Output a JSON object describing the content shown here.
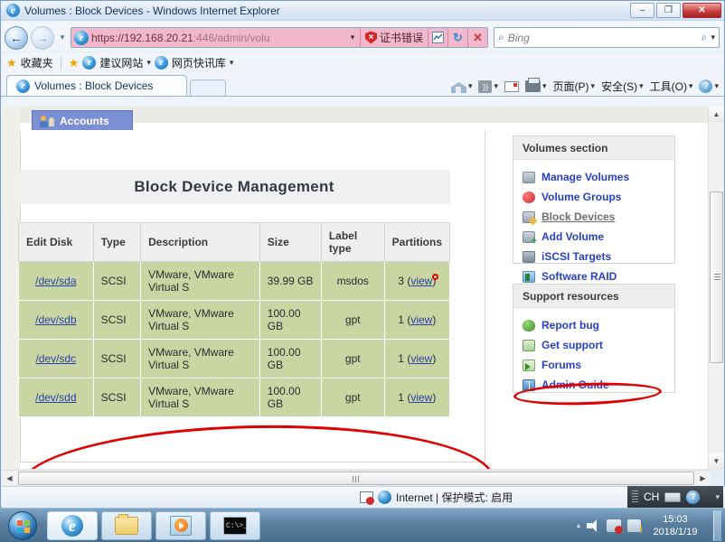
{
  "window": {
    "title": "Volumes : Block Devices - Windows Internet Explorer",
    "minimize_label": "–",
    "maximize_label": "❐",
    "close_label": "✕"
  },
  "nav": {
    "back_label": "←",
    "forward_label": "→",
    "recent_caret": "▾"
  },
  "address": {
    "url_visible": "https://192.168.20.21",
    "url_tail": ":446/admin/volu",
    "dropdown_caret": "▾",
    "cert_error_label": "证书错误",
    "compat_btn": "⚡",
    "refresh_btn": "↻",
    "stop_btn": "✕"
  },
  "search": {
    "icon": "⌕",
    "placeholder": "Bing",
    "go_icon": "⌕",
    "caret": "▾"
  },
  "favorites_bar": {
    "favorites_label": "收藏夹",
    "items": [
      {
        "label": "建议网站",
        "caret": "▾"
      },
      {
        "label": "网页快讯库",
        "caret": "▾"
      }
    ]
  },
  "tabs": {
    "active_tab": "Volumes : Block Devices"
  },
  "command_bar": {
    "items": [
      {
        "name": "home",
        "label": "",
        "caret": "▾"
      },
      {
        "name": "feeds",
        "label": "",
        "caret": "▾"
      },
      {
        "name": "mail",
        "label": "",
        "caret": ""
      },
      {
        "name": "print",
        "label": "",
        "caret": "▾"
      },
      {
        "name": "page",
        "label": "页面(P)",
        "caret": "▾"
      },
      {
        "name": "safety",
        "label": "安全(S)",
        "caret": "▾"
      },
      {
        "name": "tools",
        "label": "工具(O)",
        "caret": "▾"
      },
      {
        "name": "help",
        "label": "",
        "caret": "▾"
      }
    ]
  },
  "page": {
    "app_tab": "Accounts",
    "heading": "Block Device Management",
    "table": {
      "columns": [
        "Edit Disk",
        "Type",
        "Description",
        "Size",
        "Label type",
        "Partitions"
      ],
      "rows": [
        {
          "device": "/dev/sda",
          "type": "SCSI",
          "description": "VMware, VMware Virtual S",
          "size": "39.99 GB",
          "label_type": "msdos",
          "partitions_count": "3",
          "partitions_link": "view"
        },
        {
          "device": "/dev/sdb",
          "type": "SCSI",
          "description": "VMware, VMware Virtual S",
          "size": "100.00 GB",
          "label_type": "gpt",
          "partitions_count": "1",
          "partitions_link": "view"
        },
        {
          "device": "/dev/sdc",
          "type": "SCSI",
          "description": "VMware, VMware Virtual S",
          "size": "100.00 GB",
          "label_type": "gpt",
          "partitions_count": "1",
          "partitions_link": "view"
        },
        {
          "device": "/dev/sdd",
          "type": "SCSI",
          "description": "VMware, VMware Virtual S",
          "size": "100.00 GB",
          "label_type": "gpt",
          "partitions_count": "1",
          "partitions_link": "view"
        }
      ]
    },
    "volumes_panel": {
      "title": "Volumes section",
      "links": [
        {
          "label": "Manage Volumes",
          "icon": "drive-icon",
          "current": false
        },
        {
          "label": "Volume Groups",
          "icon": "group-icon",
          "current": false
        },
        {
          "label": "Block Devices",
          "icon": "block-device-icon",
          "current": true
        },
        {
          "label": "Add Volume",
          "icon": "add-volume-icon",
          "current": false
        },
        {
          "label": "iSCSI Targets",
          "icon": "iscsi-icon",
          "current": false
        },
        {
          "label": "Software RAID",
          "icon": "raid-icon",
          "current": false
        }
      ]
    },
    "support_panel": {
      "title": "Support resources",
      "links": [
        {
          "label": "Report bug",
          "icon": "bug-icon"
        },
        {
          "label": "Get support",
          "icon": "support-icon"
        },
        {
          "label": "Forums",
          "icon": "forums-icon"
        },
        {
          "label": "Admin Guide",
          "icon": "guide-icon"
        }
      ]
    }
  },
  "annotations": {
    "color": "#e00000",
    "marks": [
      "small-circle-above-heading",
      "ellipse-around-device-rows",
      "ellipse-around-software-raid"
    ]
  },
  "status_bar": {
    "zone_text": "Internet | 保护模式: 启用",
    "zoom_caret": "▾"
  },
  "language_bar": {
    "input_label": "CH",
    "overflow": "⬍"
  },
  "taskbar": {
    "buttons": [
      {
        "name": "internet-explorer",
        "active": true
      },
      {
        "name": "file-explorer",
        "active": false
      },
      {
        "name": "media-player",
        "active": false
      },
      {
        "name": "command-prompt",
        "active": false
      }
    ],
    "cmd_prompt_text": "C:\\>_",
    "tray_arrow": "▴",
    "clock_time": "15:03",
    "clock_date": "2018/1/19"
  }
}
